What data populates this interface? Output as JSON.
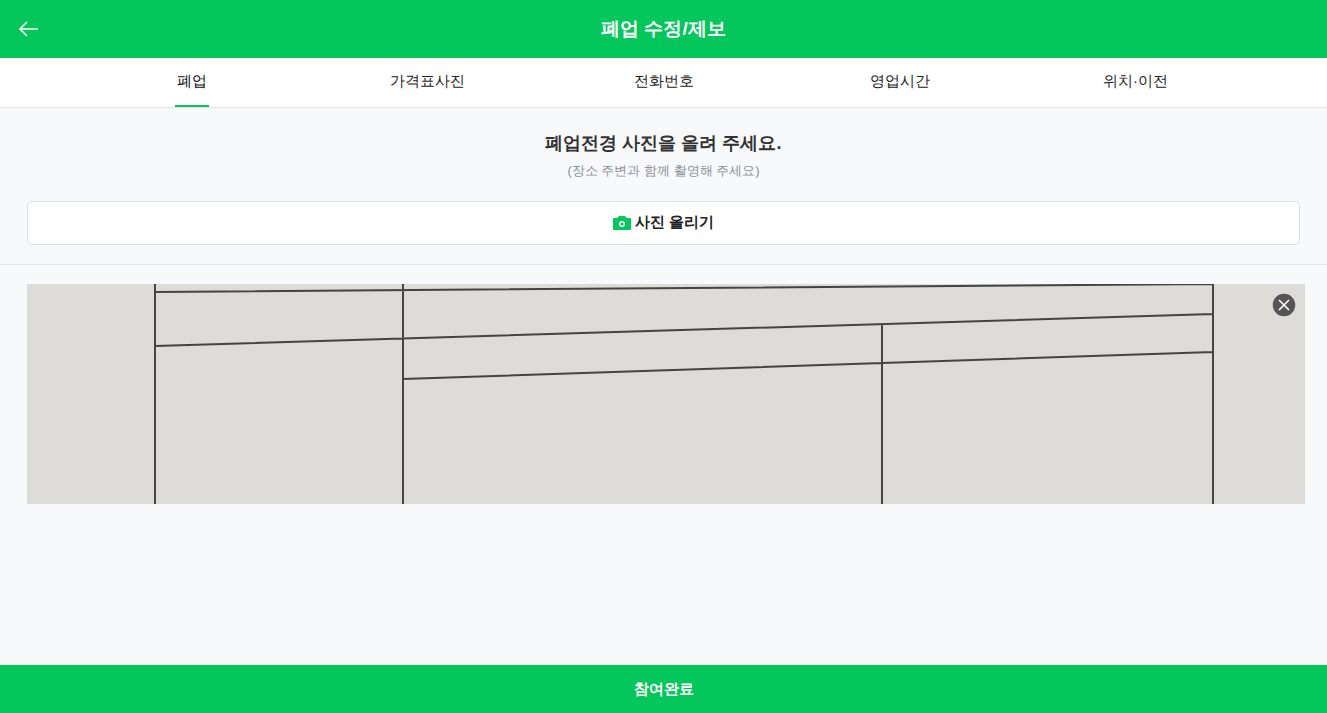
{
  "header": {
    "title": "폐업 수정/제보"
  },
  "tabs": [
    {
      "label": "폐업",
      "selected": true
    },
    {
      "label": "가격표사진",
      "selected": false
    },
    {
      "label": "전화번호",
      "selected": false
    },
    {
      "label": "영업시간",
      "selected": false
    },
    {
      "label": "위치·이전",
      "selected": false
    }
  ],
  "upload": {
    "heading": "폐업전경 사진을 올려 주세요.",
    "hint": "(장소 주변과 함께 촬영해 주세요)",
    "button": "사진 올리기"
  },
  "submit": "참여완료"
}
